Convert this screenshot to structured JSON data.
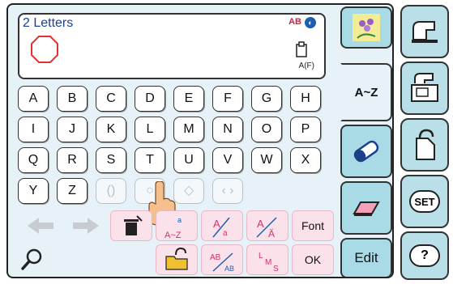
{
  "display": {
    "title": "2 Letters",
    "mode_label": "AB",
    "af_label": "A(F)"
  },
  "keyboard": {
    "row1": [
      "A",
      "B",
      "C",
      "D",
      "E",
      "F",
      "G",
      "H"
    ],
    "row2": [
      "I",
      "J",
      "K",
      "L",
      "M",
      "N",
      "O",
      "P"
    ],
    "row3": [
      "Q",
      "R",
      "S",
      "T",
      "U",
      "V",
      "W",
      "X"
    ],
    "row4": [
      "Y",
      "Z"
    ]
  },
  "tools": {
    "font_label": "Font",
    "ok_label": "OK"
  },
  "tabs": {
    "alpha_label": "A~Z",
    "edit_label": "Edit"
  },
  "sidebar": {
    "set_label": "SET",
    "help_label": "?"
  },
  "colors": {
    "panel_bg": "#e6f2f8",
    "tab_bg": "#a9dbe6",
    "tool_bg": "#fbe2ea",
    "title_text": "#1a3f99",
    "octagon": "#e83030"
  }
}
